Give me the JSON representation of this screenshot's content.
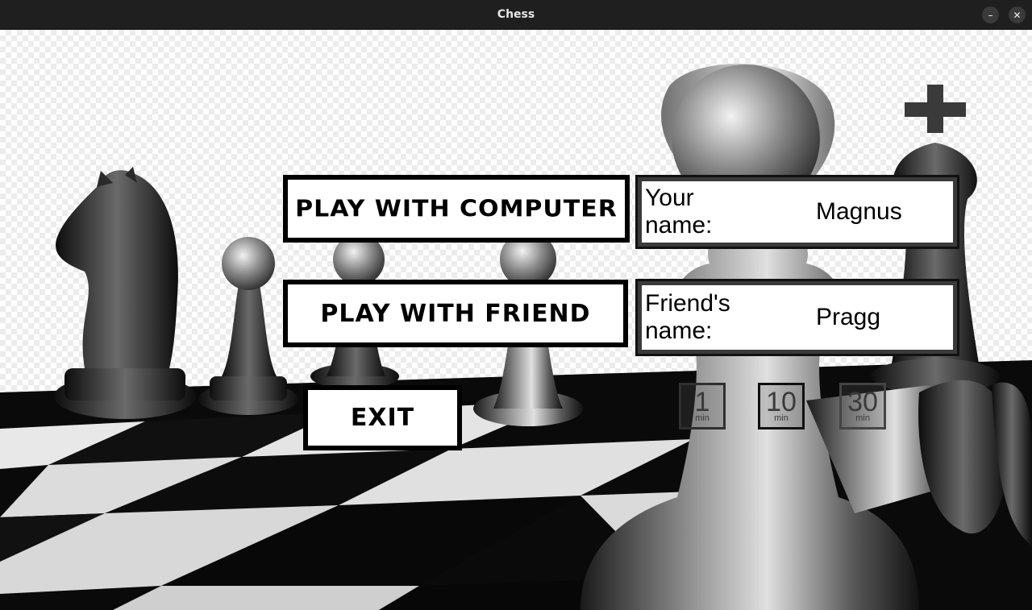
{
  "window": {
    "title": "Chess",
    "minimize_symbol": "–",
    "close_symbol": "✕"
  },
  "menu": {
    "play_computer_label": "PLAY WITH COMPUTER",
    "play_friend_label": "PLAY WITH FRIEND",
    "exit_label": "EXIT"
  },
  "fields": {
    "your_name_label": "Your name:",
    "your_name_value": "Magnus",
    "friend_name_label": "Friend's name:",
    "friend_name_value": "Pragg"
  },
  "time_controls": [
    {
      "number": "1",
      "unit": "min"
    },
    {
      "number": "10",
      "unit": "min"
    },
    {
      "number": "30",
      "unit": "min"
    }
  ],
  "colors": {
    "titlebar": "#1f1f1f",
    "button_border": "#000000",
    "button_fill": "#ffffff"
  },
  "icons": {
    "background": "chess-pieces-scene",
    "minimize": "minimize-icon",
    "close": "close-icon"
  }
}
